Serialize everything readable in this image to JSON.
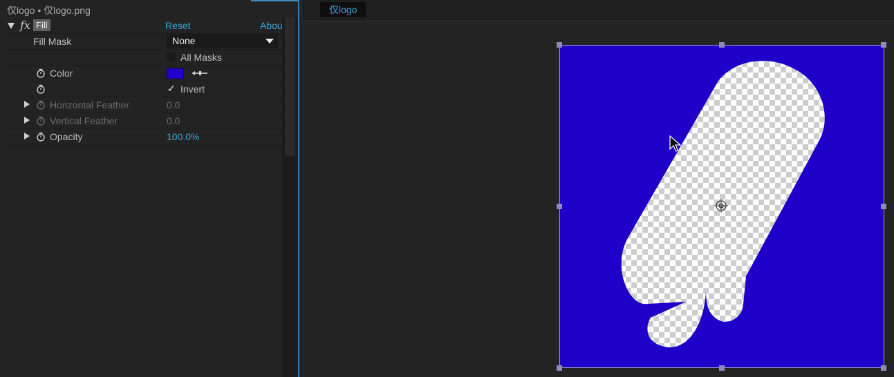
{
  "effect_controls": {
    "title": "仅logo • 仅logo.png",
    "effect": {
      "fx_symbol": "fx",
      "name": "Fill",
      "reset_label": "Reset",
      "about_label": "Abou"
    },
    "properties": {
      "fill_mask": {
        "label": "Fill Mask",
        "value": "None"
      },
      "all_masks": {
        "label": "All Masks",
        "checked": false
      },
      "color": {
        "label": "Color",
        "value": "#1f00c8"
      },
      "invert": {
        "label": "Invert",
        "checked": true,
        "check_mark": "✓"
      },
      "horizontal_feather": {
        "label": "Horizontal Feather",
        "value": "0.0"
      },
      "vertical_feather": {
        "label": "Vertical Feather",
        "value": "0.0"
      },
      "opacity": {
        "label": "Opacity",
        "value": "100.0%"
      }
    },
    "icons": [
      "stopwatch-icon",
      "eyedropper-icon",
      "expand-triangle-icon",
      "collapse-triangle-icon",
      "chevron-down-icon"
    ]
  },
  "viewer": {
    "composition_tab": "仅logo",
    "fill_color": "#1f00c8",
    "icons": [
      "anchor-point-icon",
      "mouse-cursor-icon",
      "transform-handle-icon"
    ]
  },
  "colors": {
    "panel_bg": "#232323",
    "accent_blue": "#3ea6d5",
    "fill": "#1f00c8"
  }
}
